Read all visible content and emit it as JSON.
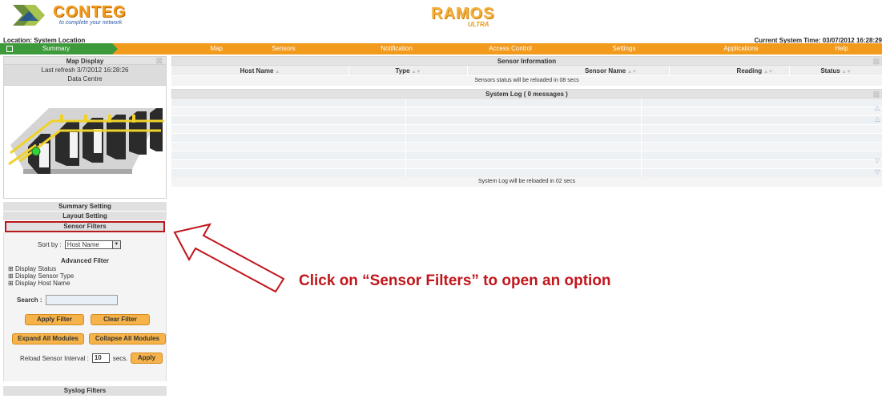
{
  "brand": {
    "conteg_name": "CONTEG",
    "conteg_tagline": "to complete your network",
    "ramos_name": "RAMOS",
    "ramos_edition": "ULTRA"
  },
  "location": "Location: System Location",
  "system_time": "Current System Time: 03/07/2012 16:28:29",
  "nav": [
    "Summary",
    "Map",
    "Sensors",
    "Notification",
    "Access Control",
    "Settings",
    "Applications",
    "Help"
  ],
  "map_display": {
    "title": "Map Display",
    "last_refresh": "Last refresh 3/7/2012 16:28:26",
    "location_name": "Data Centre"
  },
  "left_sections": {
    "summary_setting": "Summary Setting",
    "layout_setting": "Layout Setting",
    "sensor_filters": "Sensor Filters",
    "syslog_filters": "Syslog Filters"
  },
  "filters": {
    "sort_label": "Sort by :",
    "sort_value": "Host Name",
    "advanced_title": "Advanced Filter",
    "tree": [
      "Display Status",
      "Display Sensor Type",
      "Display Host Name"
    ],
    "search_label": "Search :",
    "apply_filter": "Apply Filter",
    "clear_filter": "Clear Filter",
    "expand_all": "Expand All Modules",
    "collapse_all": "Collapse All Modules",
    "reload_label": "Reload Sensor Interval :",
    "reload_value": "10",
    "reload_unit": "secs.",
    "apply": "Apply"
  },
  "sensor_info": {
    "title": "Sensor Information",
    "columns": [
      "Host Name",
      "Type",
      "Sensor Name",
      "Reading",
      "Status"
    ],
    "reload_msg": "Sensors status will be reloaded in 08 secs"
  },
  "system_log": {
    "title": "System Log ( 0 messages )",
    "reload_msg": "System Log will be reloaded in 02 secs"
  },
  "annotation": "Click on “Sensor Filters” to open an option",
  "colors": {
    "nav_orange": "#f19a1c",
    "nav_active": "#3d9a3a",
    "highlight": "#b8171b",
    "button": "#f6b34a"
  }
}
